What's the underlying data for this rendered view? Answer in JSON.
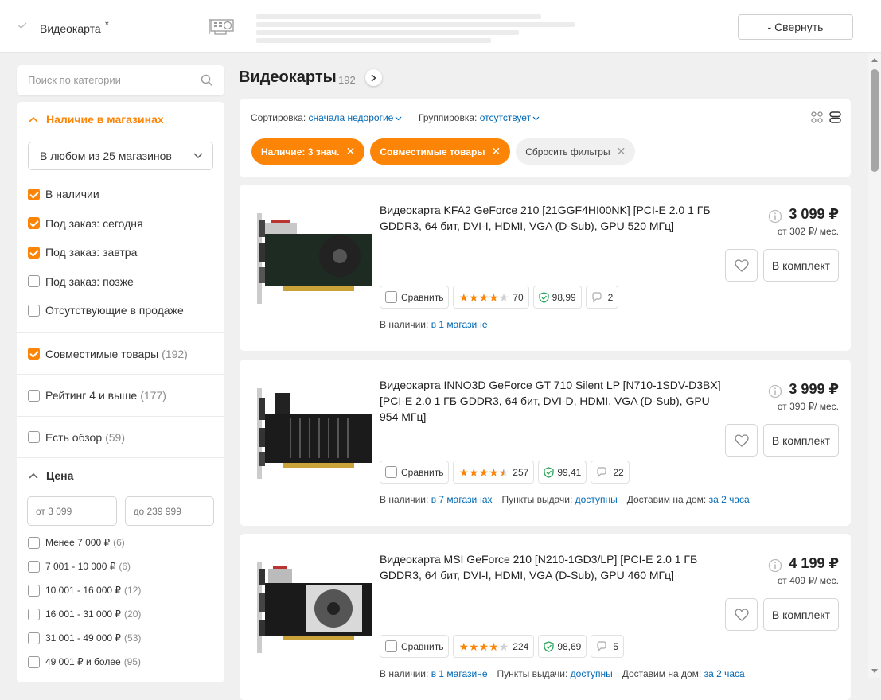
{
  "header": {
    "title": "Видеокарта",
    "asterisk": "*",
    "collapse_label": "- Свернуть"
  },
  "sidebar": {
    "search_placeholder": "Поиск по категории",
    "availability": {
      "title": "Наличие в магазинах",
      "store_select": "В любом из 25 магазинов",
      "options": [
        {
          "label": "В наличии",
          "checked": true
        },
        {
          "label": "Под заказ: сегодня",
          "checked": true
        },
        {
          "label": "Под заказ: завтра",
          "checked": true
        },
        {
          "label": "Под заказ: позже",
          "checked": false
        },
        {
          "label": "Отсутствующие в продаже",
          "checked": false
        }
      ]
    },
    "compatible": {
      "label": "Совместимые товары",
      "count": "(192)",
      "checked": true
    },
    "rating": {
      "label": "Рейтинг 4 и выше",
      "count": "(177)",
      "checked": false
    },
    "review": {
      "label": "Есть обзор",
      "count": "(59)",
      "checked": false
    },
    "price": {
      "title": "Цена",
      "from_placeholder": "от 3 099",
      "to_placeholder": "до 239 999",
      "ranges": [
        {
          "label": "Менее 7 000 ₽",
          "count": "(6)"
        },
        {
          "label": "7 001 - 10 000 ₽",
          "count": "(6)"
        },
        {
          "label": "10 001 - 16 000 ₽",
          "count": "(12)"
        },
        {
          "label": "16 001 - 31 000 ₽",
          "count": "(20)"
        },
        {
          "label": "31 001 - 49 000 ₽",
          "count": "(53)"
        },
        {
          "label": "49 001 ₽ и более",
          "count": "(95)"
        }
      ]
    }
  },
  "main": {
    "title": "Видеокарты",
    "count": "192",
    "sort_label": "Сортировка:",
    "sort_value": "сначала недорогие",
    "group_label": "Группировка:",
    "group_value": "отсутствует",
    "chips": [
      {
        "label": "Наличие: 3 знач."
      },
      {
        "label": "Совместимые товары"
      },
      {
        "label": "Сбросить фильтры"
      }
    ]
  },
  "products": [
    {
      "name": "Видеокарта KFA2 GeForce 210 [21GGF4HI00NK] [PCI-E 2.0 1 ГБ GDDR3, 64 бит, DVI-I, HDMI, VGA (D-Sub), GPU 520 МГц]",
      "price": "3 099 ₽",
      "monthly": "от 302 ₽/ мес.",
      "compare": "Сравнить",
      "rating": 4,
      "reviews": "70",
      "reliability": "98,99",
      "questions": "2",
      "cart": "В комплект",
      "avail_label": "В наличии:",
      "avail_link": "в 1 магазине",
      "pickup_label": "",
      "pickup_link": "",
      "delivery_label": "",
      "delivery_link": ""
    },
    {
      "name": "Видеокарта INNO3D GeForce GT 710 Silent LP [N710-1SDV-D3BX] [PCI-E 2.0 1 ГБ GDDR3, 64 бит, DVI-D, HDMI, VGA (D-Sub), GPU 954 МГц]",
      "price": "3 999 ₽",
      "monthly": "от 390 ₽/ мес.",
      "compare": "Сравнить",
      "rating": 4.5,
      "reviews": "257",
      "reliability": "99,41",
      "questions": "22",
      "cart": "В комплект",
      "avail_label": "В наличии:",
      "avail_link": "в 7 магазинах",
      "pickup_label": "Пункты выдачи:",
      "pickup_link": "доступны",
      "delivery_label": "Доставим на дом:",
      "delivery_link": "за 2 часа"
    },
    {
      "name": "Видеокарта MSI GeForce 210 [N210-1GD3/LP] [PCI-E 2.0 1 ГБ GDDR3, 64 бит, DVI-I, HDMI, VGA (D-Sub), GPU 460 МГц]",
      "price": "4 199 ₽",
      "monthly": "от 409 ₽/ мес.",
      "compare": "Сравнить",
      "rating": 4,
      "reviews": "224",
      "reliability": "98,69",
      "questions": "5",
      "cart": "В комплект",
      "avail_label": "В наличии:",
      "avail_link": "в 1 магазине",
      "pickup_label": "Пункты выдачи:",
      "pickup_link": "доступны",
      "delivery_label": "Доставим на дом:",
      "delivery_link": "за 2 часа"
    }
  ],
  "colors": {
    "accent": "#fc8507",
    "link": "#0069b5"
  }
}
